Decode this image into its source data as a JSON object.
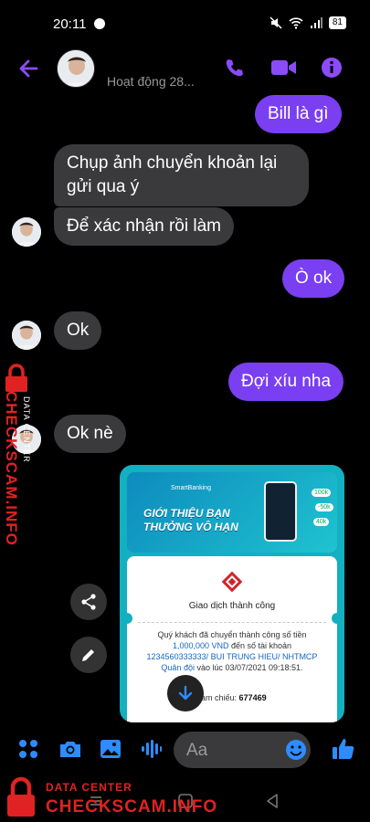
{
  "status_bar": {
    "time": "20:11",
    "battery": "81"
  },
  "header": {
    "active_status": "Hoạt động 28..."
  },
  "messages": [
    {
      "from": "out",
      "text": "Bill là gì"
    },
    {
      "from": "in",
      "text": "Chụp ảnh chuyển khoản lại gửi qua ý"
    },
    {
      "from": "in",
      "text": "Để xác nhận rồi làm"
    },
    {
      "from": "out",
      "text": "Ò ok"
    },
    {
      "from": "in",
      "text": "Ok"
    },
    {
      "from": "out",
      "text": "Đợi xíu nha"
    },
    {
      "from": "in",
      "text": "Ok nè"
    }
  ],
  "attachment": {
    "banner_brand": "SmartBanking",
    "banner_title_1": "GIỚI THIỆU BẠN",
    "banner_title_2": "THƯỞNG VÔ HẠN",
    "chip_1": "100k",
    "chip_2": "-50k",
    "chip_3": "40k",
    "receipt_title": "Giao dịch thành công",
    "receipt_line_1": "Quý khách đã chuyển thành công số tiền",
    "amount": "1,000,000 VND",
    "receipt_line_2": " đến số tài khoản",
    "account": "1234560333333/ BUI TRUNG HIEU/ NHTMCP Quân đội",
    "receipt_line_3": " vào lúc 03/07/2021 09:18:51.",
    "ref_label": "Số tham chiếu: ",
    "ref_value": "677469"
  },
  "composer": {
    "placeholder": "Aa"
  },
  "watermark": {
    "side_text": "CHECKSCAM.INFO",
    "side_sub": "DATA CENTER",
    "bottom_sub": "DATA CENTER",
    "bottom_text": "CHECKSCAM.INFO"
  },
  "colors": {
    "accent": "#7a3ff1",
    "incoming_bubble": "#3a3a3c",
    "composer_icon": "#2d8cff",
    "watermark": "#e02222"
  },
  "icons": [
    "back-arrow-icon",
    "phone-icon",
    "video-camera-icon",
    "info-icon",
    "share-icon",
    "pencil-icon",
    "arrow-down-icon",
    "apps-icon",
    "camera-icon",
    "gallery-icon",
    "microphone-icon",
    "emoji-icon",
    "like-icon"
  ]
}
